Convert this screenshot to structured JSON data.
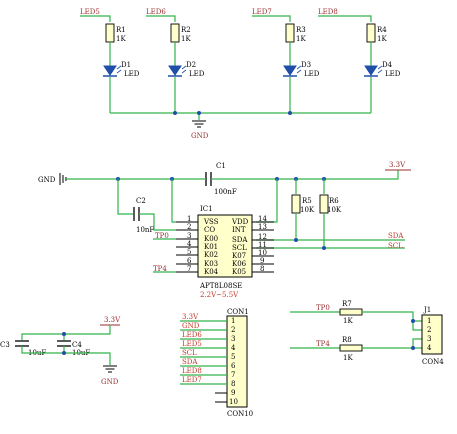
{
  "colors": {
    "wire": "#33b54a",
    "component_fill": "#ffffcc",
    "net_label": "#9b2e2e",
    "signal_label": "#c0392b",
    "led": "#1f4fa8",
    "junction": "#1f4fa8"
  },
  "led_section": {
    "net_labels": [
      "LED5",
      "LED6",
      "LED7",
      "LED8"
    ],
    "resistors": [
      {
        "ref": "R1",
        "value": "1K"
      },
      {
        "ref": "R2",
        "value": "1K"
      },
      {
        "ref": "R3",
        "value": "1K"
      },
      {
        "ref": "R4",
        "value": "1K"
      }
    ],
    "leds": [
      {
        "ref": "D1",
        "value": "LED"
      },
      {
        "ref": "D2",
        "value": "LED"
      },
      {
        "ref": "D3",
        "value": "LED"
      },
      {
        "ref": "D4",
        "value": "LED"
      }
    ],
    "gnd_label": "GND"
  },
  "ic_section": {
    "gnd_label": "GND",
    "c1": {
      "ref": "C1",
      "value": "100nF"
    },
    "c2": {
      "ref": "C2",
      "value": "10nF"
    },
    "vcc_label": "3.3V",
    "r5": {
      "ref": "R5",
      "value": "10K"
    },
    "r6": {
      "ref": "R6",
      "value": "10K"
    },
    "ic": {
      "ref": "IC1",
      "part": "APT8L08SE",
      "voltage": "2.2V~5.5V",
      "left_pins": [
        {
          "num": "1",
          "name": "VSS"
        },
        {
          "num": "2",
          "name": "CO"
        },
        {
          "num": "3",
          "name": "K00"
        },
        {
          "num": "4",
          "name": "K01"
        },
        {
          "num": "5",
          "name": "K02"
        },
        {
          "num": "6",
          "name": "K03"
        },
        {
          "num": "7",
          "name": "K04"
        }
      ],
      "right_pins": [
        {
          "num": "14",
          "name": "VDD"
        },
        {
          "num": "13",
          "name": "INT"
        },
        {
          "num": "12",
          "name": "SDA"
        },
        {
          "num": "11",
          "name": "SCL"
        },
        {
          "num": "10",
          "name": "K07"
        },
        {
          "num": "9",
          "name": "K06"
        },
        {
          "num": "8",
          "name": "K05"
        }
      ]
    },
    "tp0_label": "TP0",
    "tp4_label": "TP4",
    "sda_label": "SDA",
    "scl_label": "SCL"
  },
  "con1": {
    "ref": "CON1",
    "part": "CON10",
    "signals": [
      "3.3V",
      "GND",
      "LED6",
      "LED5",
      "SCL",
      "SDA",
      "LED8",
      "LED7",
      "",
      ""
    ],
    "pins": [
      "1",
      "2",
      "3",
      "4",
      "5",
      "6",
      "7",
      "8",
      "9",
      "10"
    ]
  },
  "caps_section": {
    "vcc_label": "3.3V",
    "c3": {
      "ref": "C3",
      "value": "10uF"
    },
    "c4": {
      "ref": "C4",
      "value": "10uF"
    },
    "gnd_label": "GND"
  },
  "j1_section": {
    "tp0_label": "TP0",
    "tp4_label": "TP4",
    "r7": {
      "ref": "R7",
      "value": "1K"
    },
    "r8": {
      "ref": "R8",
      "value": "1K"
    },
    "ref": "J1",
    "part": "CON4",
    "pins": [
      "1",
      "2",
      "3",
      "4"
    ]
  }
}
